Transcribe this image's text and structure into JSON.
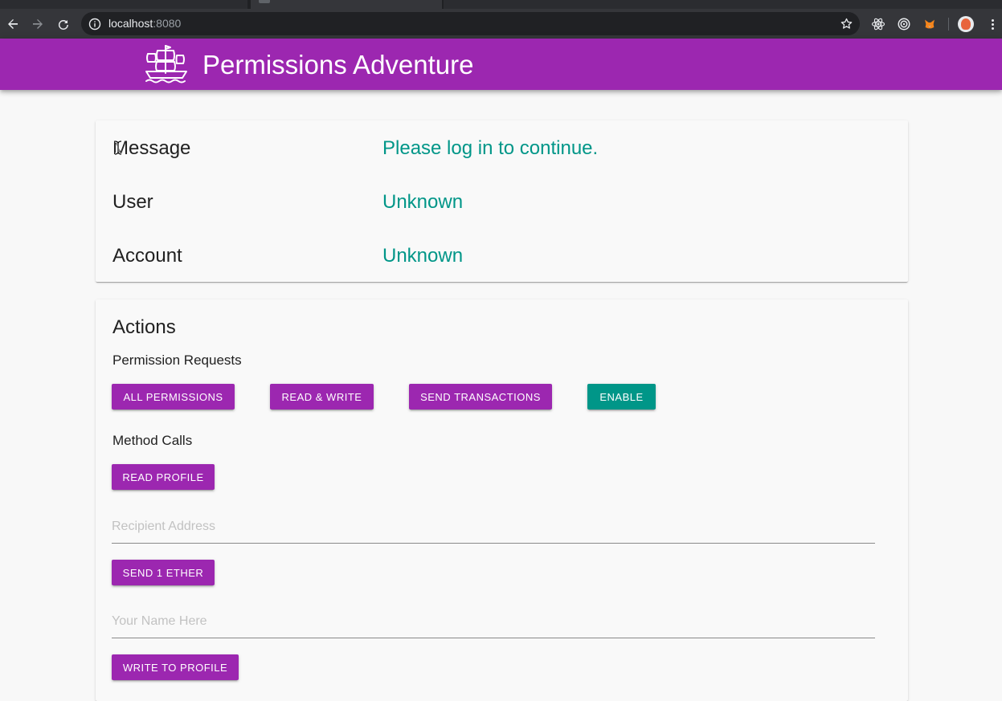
{
  "browser": {
    "url_host": "localhost",
    "url_port": ":8080"
  },
  "app": {
    "title": "Permissions Adventure",
    "colors": {
      "primary": "#9c27b0",
      "accent": "#009688"
    }
  },
  "status": {
    "rows": [
      {
        "label": "Message",
        "value": "Please log in to continue."
      },
      {
        "label": "User",
        "value": "Unknown"
      },
      {
        "label": "Account",
        "value": "Unknown"
      }
    ]
  },
  "actions": {
    "title": "Actions",
    "permission_requests": {
      "heading": "Permission Requests",
      "buttons": [
        "ALL PERMISSIONS",
        "READ & WRITE",
        "SEND TRANSACTIONS",
        "ENABLE"
      ]
    },
    "method_calls": {
      "heading": "Method Calls",
      "read_profile": "READ PROFILE",
      "recipient_placeholder": "Recipient Address",
      "send_ether": "SEND 1 ETHER",
      "name_placeholder": "Your Name Here",
      "write_profile": "WRITE TO PROFILE"
    }
  }
}
